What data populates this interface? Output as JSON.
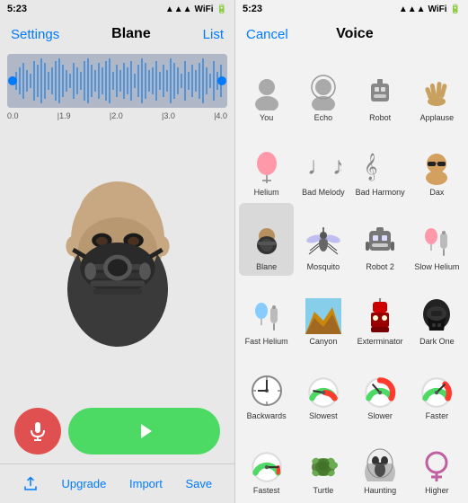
{
  "left": {
    "status": "5:23",
    "nav": {
      "left": "Settings",
      "title": "Blane",
      "right": "List"
    },
    "waveform_labels": [
      "0.0",
      "1.9",
      "2.0",
      "3.0",
      "4.0"
    ],
    "controls": {
      "mic_label": "mic",
      "play_label": "play"
    },
    "toolbar": {
      "share_label": "Share",
      "upgrade_label": "Upgrade",
      "import_label": "Import",
      "save_label": "Save"
    }
  },
  "right": {
    "status": "5:23",
    "nav": {
      "cancel": "Cancel",
      "title": "Voice",
      "list": ""
    },
    "voices": [
      {
        "id": "you",
        "label": "You",
        "icon": "person",
        "selected": false
      },
      {
        "id": "echo",
        "label": "Echo",
        "icon": "echo",
        "selected": false
      },
      {
        "id": "robot",
        "label": "Robot",
        "icon": "robot",
        "selected": false
      },
      {
        "id": "applause",
        "label": "Applause",
        "icon": "applause",
        "selected": false
      },
      {
        "id": "helium",
        "label": "Helium",
        "icon": "helium",
        "selected": false
      },
      {
        "id": "bad-melody",
        "label": "Bad Melody",
        "icon": "badmelody",
        "selected": false
      },
      {
        "id": "bad-harmony",
        "label": "Bad Harmony",
        "icon": "badharmony",
        "selected": false
      },
      {
        "id": "dax",
        "label": "Dax",
        "icon": "dax",
        "selected": false
      },
      {
        "id": "blane",
        "label": "Blane",
        "icon": "blane",
        "selected": true
      },
      {
        "id": "mosquito",
        "label": "Mosquito",
        "icon": "mosquito",
        "selected": false
      },
      {
        "id": "robot2",
        "label": "Robot 2",
        "icon": "robot2",
        "selected": false
      },
      {
        "id": "slowhelium",
        "label": "Slow Helium",
        "icon": "slowhelium",
        "selected": false
      },
      {
        "id": "fasthelium",
        "label": "Fast Helium",
        "icon": "fasthelium",
        "selected": false
      },
      {
        "id": "canyon",
        "label": "Canyon",
        "icon": "canyon",
        "selected": false
      },
      {
        "id": "exterminator",
        "label": "Exterminator",
        "icon": "exterminator",
        "selected": false
      },
      {
        "id": "darkone",
        "label": "Dark One",
        "icon": "darkone",
        "selected": false
      },
      {
        "id": "backwards",
        "label": "Backwards",
        "icon": "backwards",
        "selected": false
      },
      {
        "id": "slowest",
        "label": "Slowest",
        "icon": "slowest",
        "selected": false
      },
      {
        "id": "slower",
        "label": "Slower",
        "icon": "slower",
        "selected": false
      },
      {
        "id": "faster",
        "label": "Faster",
        "icon": "faster",
        "selected": false
      },
      {
        "id": "fastest",
        "label": "Fastest",
        "icon": "fastest",
        "selected": false
      },
      {
        "id": "turtle",
        "label": "Turtle",
        "icon": "turtle",
        "selected": false
      },
      {
        "id": "haunting",
        "label": "Haunting",
        "icon": "haunting",
        "selected": false
      },
      {
        "id": "higher",
        "label": "Higher",
        "icon": "higher",
        "selected": false
      }
    ]
  }
}
